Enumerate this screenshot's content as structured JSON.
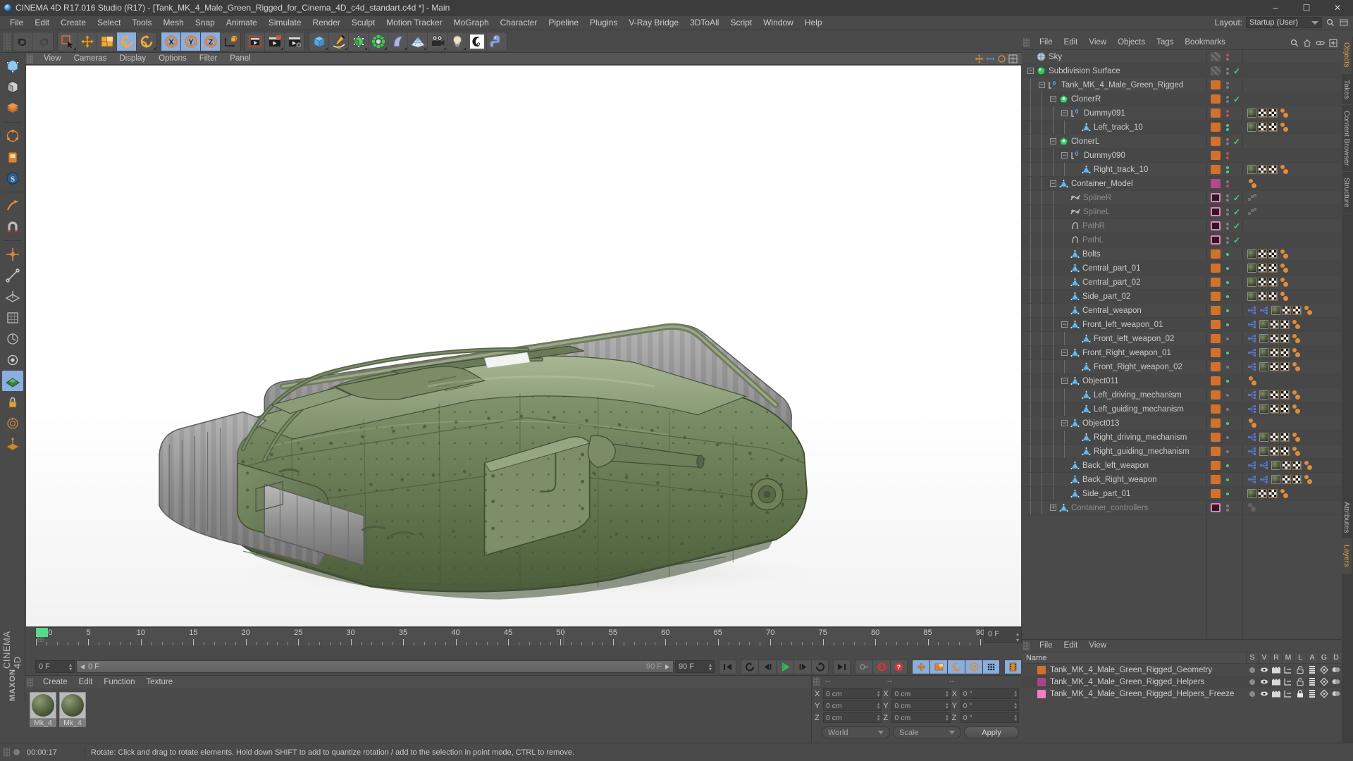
{
  "window": {
    "title": "CINEMA 4D R17.016 Studio (R17) - [Tank_MK_4_Male_Green_Rigged_for_Cinema_4D_c4d_standart.c4d *] - Main",
    "minimize": "–",
    "maximize": "☐",
    "close": "✕"
  },
  "menubar": {
    "items": [
      "File",
      "Edit",
      "Create",
      "Select",
      "Tools",
      "Mesh",
      "Snap",
      "Animate",
      "Simulate",
      "Render",
      "Sculpt",
      "Motion Tracker",
      "MoGraph",
      "Character",
      "Pipeline",
      "Plugins",
      "V-Ray Bridge",
      "3DToAll",
      "Script",
      "Window",
      "Help"
    ],
    "layout_label": "Layout:",
    "layout_value": "Startup (User)"
  },
  "viewport": {
    "menus": [
      "View",
      "Cameras",
      "Display",
      "Options",
      "Filter",
      "Panel"
    ],
    "scene": "Tank MK IV Male, green, rigged — perspective view"
  },
  "timeline": {
    "labels": [
      "0",
      "5",
      "10",
      "15",
      "20",
      "25",
      "30",
      "35",
      "40",
      "45",
      "50",
      "55",
      "60",
      "65",
      "70",
      "75",
      "80",
      "85",
      "90"
    ],
    "start_frame": "0 F",
    "end_frame": "90 F",
    "current_frame_left": "0 F",
    "current_frame_right": "0 F",
    "preview_end": "90 F",
    "frame_box": "0 F"
  },
  "materials": {
    "menus": [
      "Create",
      "Edit",
      "Function",
      "Texture"
    ],
    "items": [
      {
        "name": "Mk_4"
      },
      {
        "name": "Mk_4"
      }
    ]
  },
  "coordinates": {
    "header_dashes": [
      "--",
      "--",
      "--"
    ],
    "axes": [
      "X",
      "Y",
      "Z"
    ],
    "position": [
      "0 cm",
      "0 cm",
      "0 cm"
    ],
    "size": [
      "0 cm",
      "0 cm",
      "0 cm"
    ],
    "rotation": [
      "0 °",
      "0 °",
      "0 °"
    ],
    "coord_system": "World",
    "mode": "Scale",
    "apply_label": "Apply"
  },
  "object_manager": {
    "menus": [
      "File",
      "Edit",
      "View",
      "Objects",
      "Tags",
      "Bookmarks"
    ],
    "rows": [
      {
        "label": "Sky",
        "depth": 0,
        "expander": "none",
        "icon": "sky",
        "color": "none",
        "dots": [
          "red",
          "gray"
        ],
        "check": false,
        "dim": false,
        "tags": []
      },
      {
        "label": "Subdivision Surface",
        "depth": 0,
        "expander": "minus",
        "icon": "subdiv",
        "color": "none",
        "dots": [
          "gray",
          "gray"
        ],
        "check": true,
        "dim": false,
        "tags": []
      },
      {
        "label": "Tank_MK_4_Male_Green_Rigged",
        "depth": 1,
        "expander": "minus",
        "icon": "null0",
        "color": "#d2722a",
        "dots": [
          "gray",
          "gray"
        ],
        "check": false,
        "dim": false,
        "tags": []
      },
      {
        "label": "ClonerR",
        "depth": 2,
        "expander": "minus",
        "icon": "cloner",
        "color": "#d2722a",
        "dots": [
          "gray",
          "gray"
        ],
        "check": true,
        "dim": false,
        "tags": []
      },
      {
        "label": "Dummy091",
        "depth": 3,
        "expander": "minus",
        "icon": "null0",
        "color": "#d2722a",
        "dots": [
          "red",
          "red"
        ],
        "check": false,
        "dim": false,
        "tags": [
          "mat",
          "checker",
          "checker",
          "dots"
        ]
      },
      {
        "label": "Left_track_10",
        "depth": 4,
        "expander": "none",
        "icon": "poly",
        "color": "#d2722a",
        "dots": [
          "green",
          "green"
        ],
        "check": false,
        "dim": false,
        "tags": [
          "mat",
          "checker",
          "checker",
          "dots"
        ]
      },
      {
        "label": "ClonerL",
        "depth": 2,
        "expander": "minus",
        "icon": "cloner",
        "color": "#d2722a",
        "dots": [
          "gray",
          "gray"
        ],
        "check": true,
        "dim": false,
        "tags": []
      },
      {
        "label": "Dummy090",
        "depth": 3,
        "expander": "minus",
        "icon": "null0",
        "color": "#d2722a",
        "dots": [
          "red",
          "red"
        ],
        "check": false,
        "dim": false,
        "tags": []
      },
      {
        "label": "Right_track_10",
        "depth": 4,
        "expander": "none",
        "icon": "poly",
        "color": "#d2722a",
        "dots": [
          "green",
          "green"
        ],
        "check": false,
        "dim": false,
        "tags": [
          "mat",
          "checker",
          "checker",
          "dots"
        ]
      },
      {
        "label": "Container_Model",
        "depth": 2,
        "expander": "minus",
        "icon": "poly",
        "color": "#b5488f",
        "dots": [
          "gray",
          "red"
        ],
        "check": false,
        "dim": false,
        "tags": [
          "dots"
        ]
      },
      {
        "label": "SplineR",
        "depth": 3,
        "expander": "none",
        "icon": "spline",
        "color": "#ef7fc0",
        "dots": [
          "gray",
          "gray"
        ],
        "check": true,
        "dim": true,
        "tags": [
          "gcheck"
        ]
      },
      {
        "label": "SplineL",
        "depth": 3,
        "expander": "none",
        "icon": "spline",
        "color": "#ef7fc0",
        "dots": [
          "gray",
          "gray"
        ],
        "check": true,
        "dim": true,
        "tags": [
          "gcheck"
        ]
      },
      {
        "label": "PathR",
        "depth": 3,
        "expander": "none",
        "icon": "path",
        "color": "#ef7fc0",
        "dots": [
          "gray",
          "gray"
        ],
        "check": true,
        "dim": true,
        "tags": []
      },
      {
        "label": "PathL",
        "depth": 3,
        "expander": "none",
        "icon": "path",
        "color": "#ef7fc0",
        "dots": [
          "gray",
          "gray"
        ],
        "check": true,
        "dim": true,
        "tags": []
      },
      {
        "label": "Bolts",
        "depth": 3,
        "expander": "none",
        "icon": "poly",
        "color": "#d2722a",
        "dots": [
          "green"
        ],
        "check": false,
        "dim": false,
        "tags": [
          "mat",
          "checker",
          "checker",
          "dots"
        ]
      },
      {
        "label": "Central_part_01",
        "depth": 3,
        "expander": "none",
        "icon": "poly",
        "color": "#d2722a",
        "dots": [
          "green"
        ],
        "check": false,
        "dim": false,
        "tags": [
          "mat",
          "checker",
          "checker",
          "dots"
        ]
      },
      {
        "label": "Central_part_02",
        "depth": 3,
        "expander": "none",
        "icon": "poly",
        "color": "#d2722a",
        "dots": [
          "green"
        ],
        "check": false,
        "dim": false,
        "tags": [
          "mat",
          "checker",
          "checker",
          "dots"
        ]
      },
      {
        "label": "Side_part_02",
        "depth": 3,
        "expander": "none",
        "icon": "poly",
        "color": "#d2722a",
        "dots": [
          "green"
        ],
        "check": false,
        "dim": false,
        "tags": [
          "mat",
          "checker",
          "checker",
          "dots"
        ]
      },
      {
        "label": "Central_weapon",
        "depth": 3,
        "expander": "none",
        "icon": "poly",
        "color": "#d2722a",
        "dots": [
          "green"
        ],
        "check": false,
        "dim": false,
        "tags": [
          "blue",
          "blue",
          "mat",
          "checker",
          "checker",
          "dots"
        ]
      },
      {
        "label": "Front_left_weapon_01",
        "depth": 3,
        "expander": "minus",
        "icon": "poly",
        "color": "#d2722a",
        "dots": [
          "green"
        ],
        "check": false,
        "dim": false,
        "tags": [
          "blue",
          "mat",
          "checker",
          "checker",
          "dots"
        ]
      },
      {
        "label": "Front_left_weapon_02",
        "depth": 4,
        "expander": "none",
        "icon": "poly",
        "color": "#d2722a",
        "dots": [
          "gray"
        ],
        "check": false,
        "dim": false,
        "tags": [
          "blue",
          "mat",
          "checker",
          "checker",
          "dots"
        ]
      },
      {
        "label": "Front_Right_weapon_01",
        "depth": 3,
        "expander": "minus",
        "icon": "poly",
        "color": "#d2722a",
        "dots": [
          "green"
        ],
        "check": false,
        "dim": false,
        "tags": [
          "blue",
          "mat",
          "checker",
          "checker",
          "dots"
        ]
      },
      {
        "label": "Front_Right_weapon_02",
        "depth": 4,
        "expander": "none",
        "icon": "poly",
        "color": "#d2722a",
        "dots": [
          "gray"
        ],
        "check": false,
        "dim": false,
        "tags": [
          "blue",
          "mat",
          "checker",
          "checker",
          "dots"
        ]
      },
      {
        "label": "Object011",
        "depth": 3,
        "expander": "minus",
        "icon": "poly",
        "color": "#d2722a",
        "dots": [
          "green"
        ],
        "check": false,
        "dim": false,
        "tags": [
          "dots"
        ]
      },
      {
        "label": "Left_driving_mechanism",
        "depth": 4,
        "expander": "none",
        "icon": "poly",
        "color": "#d2722a",
        "dots": [
          "gray"
        ],
        "check": false,
        "dim": false,
        "tags": [
          "blue",
          "mat",
          "checker",
          "checker",
          "dots"
        ]
      },
      {
        "label": "Left_guiding_mechanism",
        "depth": 4,
        "expander": "none",
        "icon": "poly",
        "color": "#d2722a",
        "dots": [
          "gray"
        ],
        "check": false,
        "dim": false,
        "tags": [
          "blue",
          "mat",
          "checker",
          "checker",
          "dots"
        ]
      },
      {
        "label": "Object013",
        "depth": 3,
        "expander": "minus",
        "icon": "poly",
        "color": "#d2722a",
        "dots": [
          "green"
        ],
        "check": false,
        "dim": false,
        "tags": [
          "dots"
        ]
      },
      {
        "label": "Right_driving_mechanism",
        "depth": 4,
        "expander": "none",
        "icon": "poly",
        "color": "#d2722a",
        "dots": [
          "gray"
        ],
        "check": false,
        "dim": false,
        "tags": [
          "blue",
          "mat",
          "checker",
          "checker",
          "dots"
        ]
      },
      {
        "label": "Right_guiding_mechanism",
        "depth": 4,
        "expander": "none",
        "icon": "poly",
        "color": "#d2722a",
        "dots": [
          "gray"
        ],
        "check": false,
        "dim": false,
        "tags": [
          "blue",
          "mat",
          "checker",
          "checker",
          "dots"
        ]
      },
      {
        "label": "Back_left_weapon",
        "depth": 3,
        "expander": "none",
        "icon": "poly",
        "color": "#d2722a",
        "dots": [
          "green"
        ],
        "check": false,
        "dim": false,
        "tags": [
          "blue",
          "blue",
          "mat",
          "checker",
          "checker",
          "dots"
        ]
      },
      {
        "label": "Back_Right_weapon",
        "depth": 3,
        "expander": "none",
        "icon": "poly",
        "color": "#d2722a",
        "dots": [
          "green"
        ],
        "check": false,
        "dim": false,
        "tags": [
          "blue",
          "blue",
          "mat",
          "checker",
          "checker",
          "dots"
        ]
      },
      {
        "label": "Side_part_01",
        "depth": 3,
        "expander": "none",
        "icon": "poly",
        "color": "#d2722a",
        "dots": [
          "green"
        ],
        "check": false,
        "dim": false,
        "tags": [
          "mat",
          "checker",
          "checker",
          "dots"
        ]
      },
      {
        "label": "Container_controllers",
        "depth": 2,
        "expander": "plus",
        "icon": "poly",
        "color": "#ef7fc0",
        "dots": [
          "gray",
          "gray"
        ],
        "check": false,
        "dim": true,
        "tags": [
          "grayballs"
        ]
      }
    ],
    "side_tabs": [
      "Objects",
      "Takes",
      "Content Browser",
      "Structure"
    ]
  },
  "layer_manager": {
    "menus": [
      "File",
      "Edit",
      "View"
    ],
    "columns": [
      "Name",
      "S",
      "V",
      "R",
      "M",
      "L",
      "A",
      "G",
      "D"
    ],
    "rows": [
      {
        "name": "Tank_MK_4_Male_Green_Rigged_Geometry",
        "color": "#d2722a",
        "locked": false
      },
      {
        "name": "Tank_MK_4_Male_Green_Rigged_Helpers",
        "color": "#a8448a",
        "locked": false
      },
      {
        "name": "Tank_MK_4_Male_Green_Rigged_Helpers_Freeze",
        "color": "#f27cc0",
        "locked": true
      }
    ],
    "side_tabs": [
      "Attributes",
      "Layers"
    ]
  },
  "statusbar": {
    "time": "00:00:17",
    "message": "Rotate: Click and drag to rotate elements. Hold down SHIFT to add to quantize rotation / add to the selection in point mode, CTRL to remove."
  },
  "brand": "CINEMA 4D",
  "brand_maxon": "MAXON"
}
